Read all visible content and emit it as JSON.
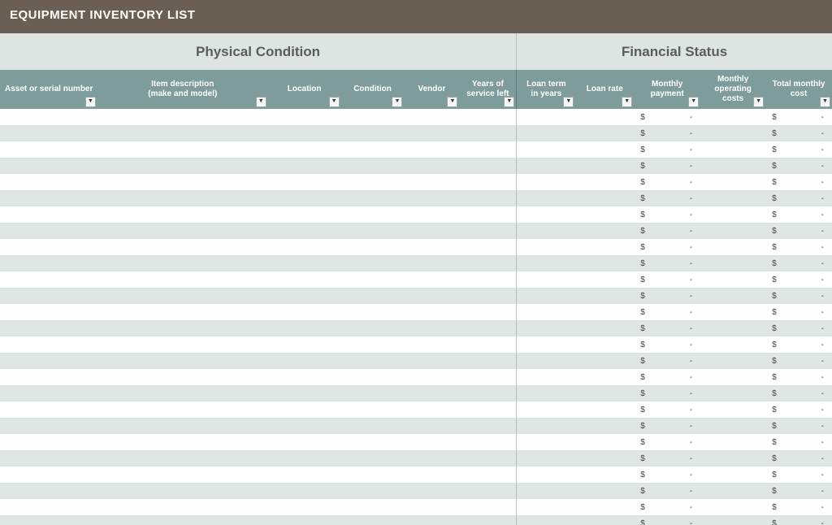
{
  "title": "EQUIPMENT INVENTORY LIST",
  "sections": {
    "physical": "Physical Condition",
    "financial": "Financial Status"
  },
  "headers": {
    "asset": "Asset or serial number",
    "desc_l1": "Item description",
    "desc_l2": "(make and model)",
    "loc": "Location",
    "cond": "Condition",
    "vend": "Vendor",
    "svc_l1": "Years of",
    "svc_l2": "service left",
    "term_l1": "Loan term",
    "term_l2": "in years",
    "rate": "Loan rate",
    "mpay_l1": "Monthly",
    "mpay_l2": "payment",
    "opex_l1": "Monthly",
    "opex_l2": "operating",
    "opex_l3": "costs",
    "total_l1": "Total monthly",
    "total_l2": "cost"
  },
  "currency": "$",
  "dash": "-",
  "row_count": 26
}
